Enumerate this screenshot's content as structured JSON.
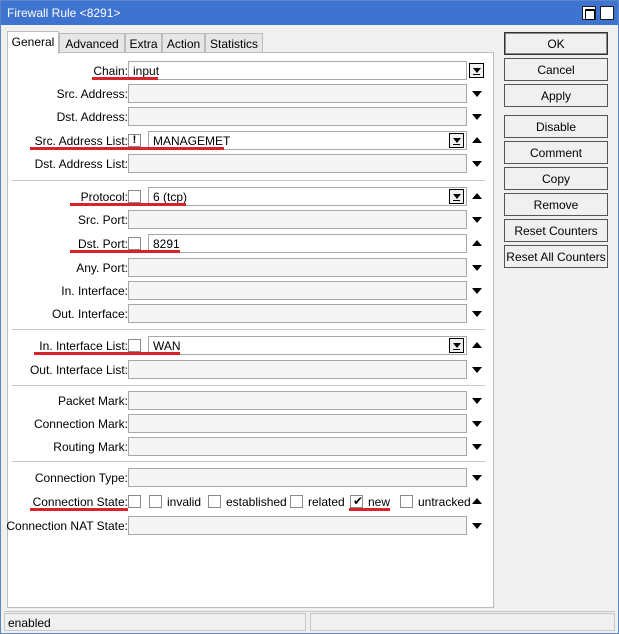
{
  "window": {
    "title": "Firewall Rule <8291>",
    "maximize_icon": "maximize-icon",
    "close_glyph": "×"
  },
  "tabs": [
    "General",
    "Advanced",
    "Extra",
    "Action",
    "Statistics"
  ],
  "fields": {
    "chain": {
      "label": "Chain:",
      "value": "input"
    },
    "src_address": {
      "label": "Src. Address:"
    },
    "dst_address": {
      "label": "Dst. Address:"
    },
    "src_address_list": {
      "label": "Src. Address List:",
      "negate": "!",
      "value": "MANAGEMET"
    },
    "dst_address_list": {
      "label": "Dst. Address List:"
    },
    "protocol": {
      "label": "Protocol:",
      "value": "6 (tcp)"
    },
    "src_port": {
      "label": "Src. Port:"
    },
    "dst_port": {
      "label": "Dst. Port:",
      "value": "8291"
    },
    "any_port": {
      "label": "Any. Port:"
    },
    "in_interface": {
      "label": "In. Interface:"
    },
    "out_interface": {
      "label": "Out. Interface:"
    },
    "in_interface_list": {
      "label": "In. Interface List:",
      "value": "WAN"
    },
    "out_interface_list": {
      "label": "Out. Interface List:"
    },
    "packet_mark": {
      "label": "Packet Mark:"
    },
    "connection_mark": {
      "label": "Connection Mark:"
    },
    "routing_mark": {
      "label": "Routing Mark:"
    },
    "connection_type": {
      "label": "Connection Type:"
    },
    "connection_state": {
      "label": "Connection State:",
      "options": [
        {
          "name": "invalid",
          "checked": false
        },
        {
          "name": "established",
          "checked": false
        },
        {
          "name": "related",
          "checked": false
        },
        {
          "name": "new",
          "checked": true
        },
        {
          "name": "untracked",
          "checked": false
        }
      ]
    },
    "connection_nat_state": {
      "label": "Connection NAT State:"
    }
  },
  "buttons": [
    "OK",
    "Cancel",
    "Apply",
    "Disable",
    "Comment",
    "Copy",
    "Remove",
    "Reset Counters",
    "Reset All Counters"
  ],
  "status": {
    "text": "enabled"
  },
  "colors": {
    "titlebar": "#3e73d0",
    "highlight": "#d8232a"
  }
}
